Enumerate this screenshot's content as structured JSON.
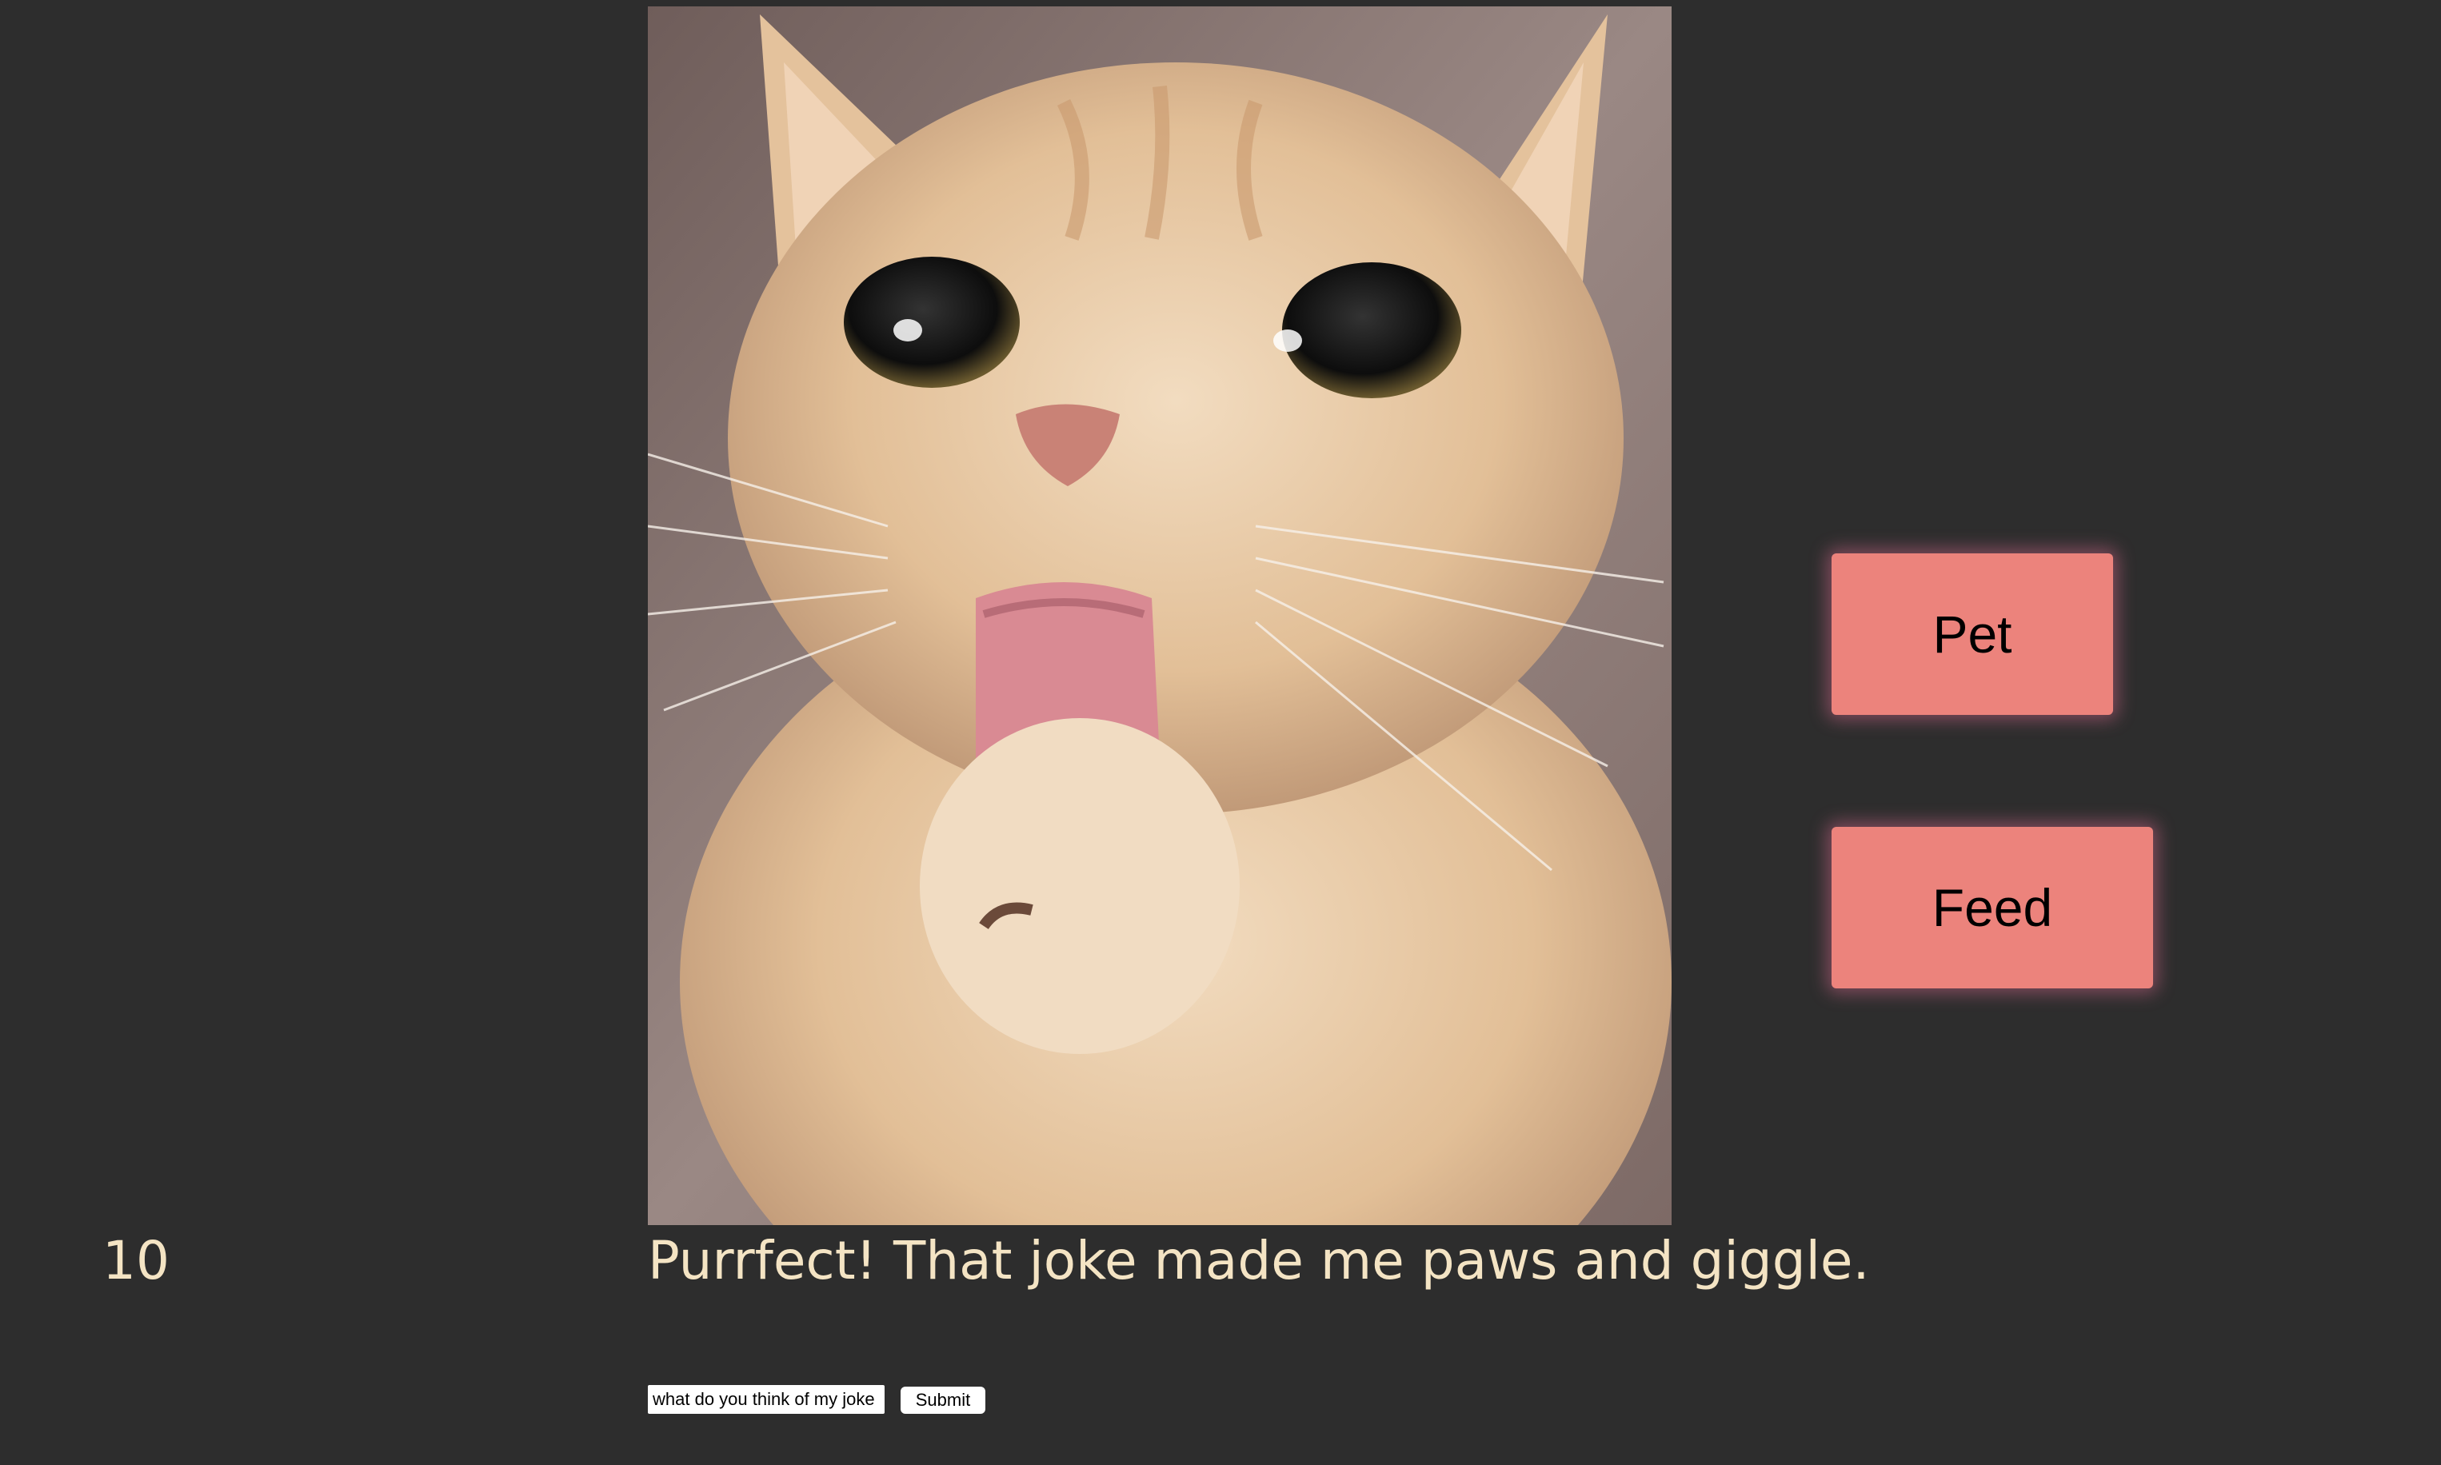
{
  "photo": {
    "subject": "cat-licking-paw"
  },
  "controls": {
    "pet_label": "Pet",
    "feed_label": "Feed"
  },
  "status": {
    "counter": "10",
    "message": "Purrfect! That joke made me paws and giggle."
  },
  "joke_form": {
    "input_value": "what do you think of my joke",
    "submit_label": "Submit"
  },
  "colors": {
    "background": "#2d2d2d",
    "text": "#f4e4c4",
    "button": "#ec837c"
  }
}
